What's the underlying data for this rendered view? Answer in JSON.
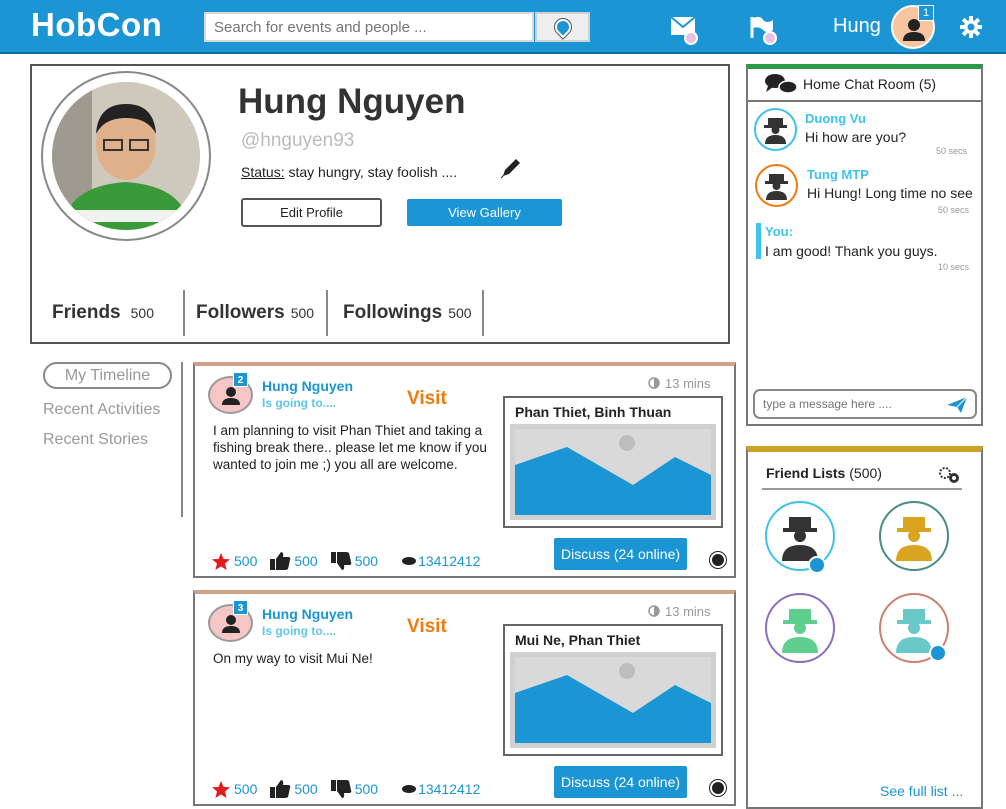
{
  "app": {
    "name": "HobCon"
  },
  "header": {
    "search_placeholder": "Search for events and people ...",
    "username": "Hung",
    "notification_count": "1"
  },
  "profile": {
    "name": "Hung Nguyen",
    "handle": "@hnguyen93",
    "status_label": "Status:",
    "status_text": " stay hungry, stay foolish ....",
    "edit_button": "Edit Profile",
    "gallery_button": "View Gallery",
    "stats": [
      {
        "label": "Friends",
        "value": "500"
      },
      {
        "label": "Followers",
        "value": "500"
      },
      {
        "label": "Followings",
        "value": "500"
      }
    ]
  },
  "nav": {
    "items": [
      "My Timeline",
      "Recent Activities",
      "Recent Stories"
    ]
  },
  "posts": [
    {
      "badge": "2",
      "author": "Hung Nguyen",
      "subtitle": "Is going to....",
      "type": "Visit",
      "time": "13 mins",
      "body": "I am planning to visit Phan Thiet and taking a fishing break there.. please let me know if you wanted to join me ;) you all are welcome.",
      "place": "Phan Thiet, Binh Thuan",
      "discuss": "Discuss (24 online)",
      "likes": "500",
      "thumbs_up": "500",
      "thumbs_down": "500",
      "views": "13412412"
    },
    {
      "badge": "3",
      "author": "Hung Nguyen",
      "subtitle": "Is going to....",
      "type": "Visit",
      "time": "13 mins",
      "body": "On my way to visit Mui Ne!",
      "place": "Mui Ne, Phan Thiet",
      "discuss": "Discuss (24 online)",
      "likes": "500",
      "thumbs_up": "500",
      "thumbs_down": "500",
      "views": "13412412"
    }
  ],
  "chat": {
    "title": "Home Chat Room (5)",
    "messages": [
      {
        "name": "Duong Vu",
        "text": "Hi how are you?",
        "time": "50 secs"
      },
      {
        "name": "Tung MTP",
        "text": "Hi Hung! Long time no see",
        "time": "50 secs"
      },
      {
        "name": "You:",
        "text": "I am good! Thank you guys.",
        "time": "10 secs"
      }
    ],
    "input_placeholder": "type a message here ...."
  },
  "friends": {
    "title": "Friend Lists",
    "count": "(500)",
    "see_full": "See full list ..."
  },
  "colors": {
    "brand": "#1b95d3",
    "accent_orange": "#f07b0e",
    "chat_green": "#2a9a4a",
    "friends_gold": "#c9a227"
  }
}
